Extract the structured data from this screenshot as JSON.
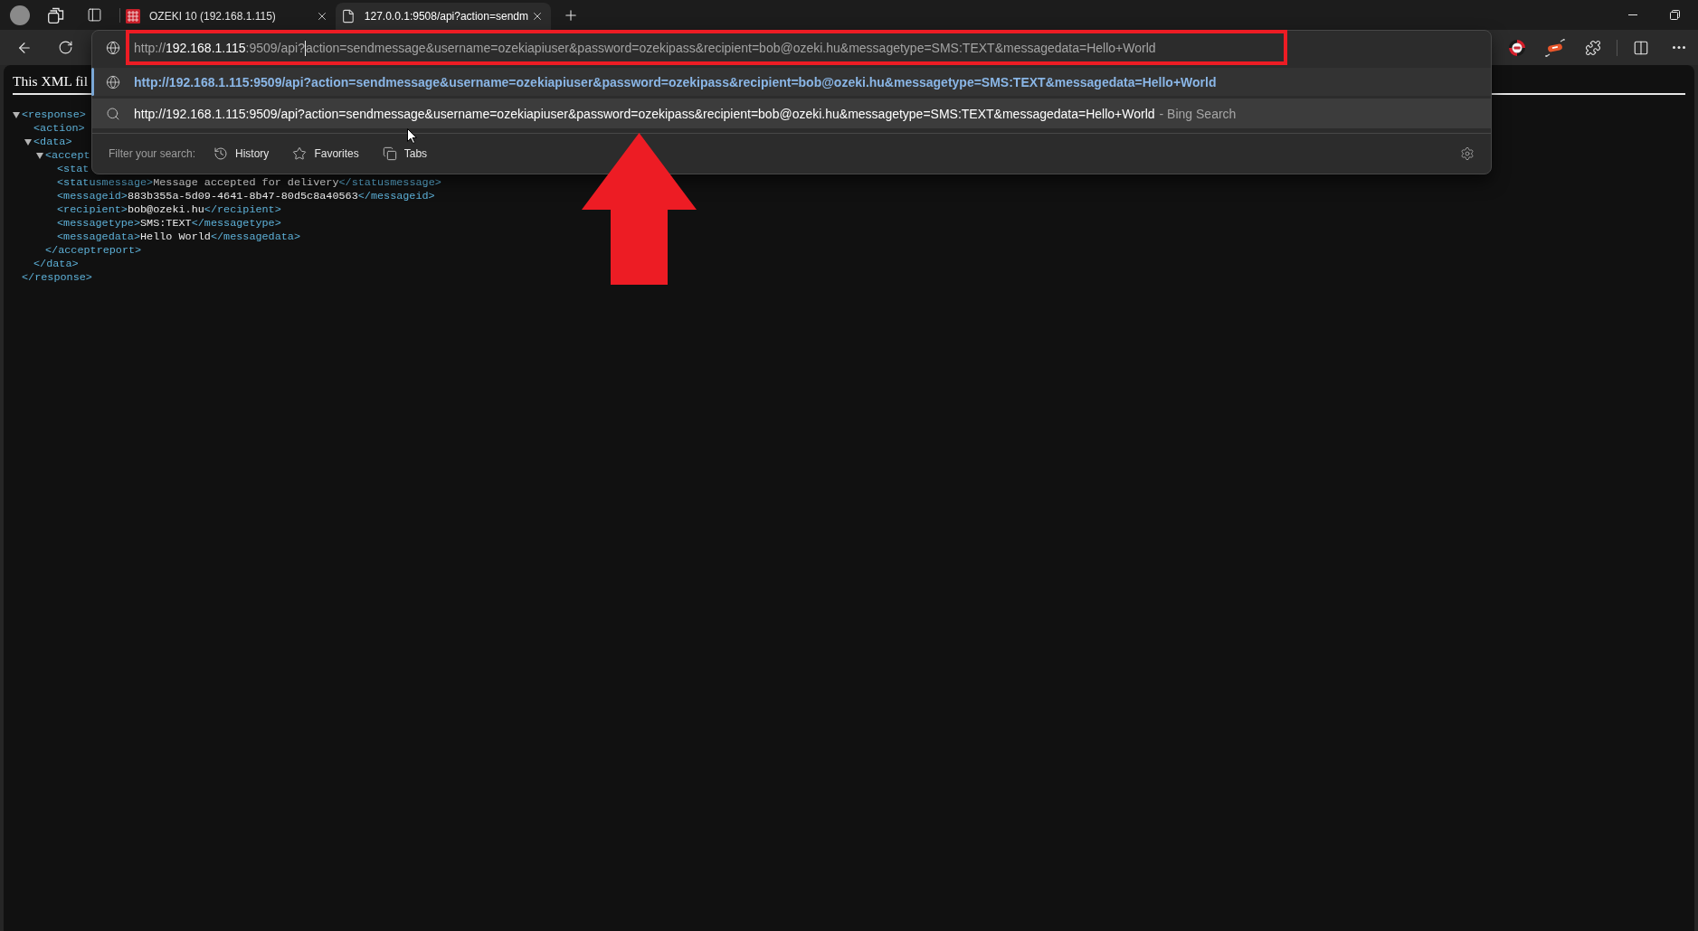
{
  "tabs": [
    {
      "title": "OZEKI 10 (192.168.1.115)",
      "kind": "grid",
      "selected": false
    },
    {
      "title": "127.0.0.1:9508/api?action=sendm",
      "kind": "document",
      "selected": true
    }
  ],
  "address_bar": {
    "scheme": "http://",
    "host": "192.168.1.115",
    "path": ":9509/api?",
    "query": "action=sendmessage&username=ozekiapiuser&password=ozekipass&recipient=bob@ozeki.hu&messagetype=SMS:TEXT&messagedata=Hello+World"
  },
  "suggestions": [
    {
      "kind": "url",
      "text": "http://192.168.1.115:9509/api?action=sendmessage&username=ozekiapiuser&password=ozekipass&recipient=bob@ozeki.hu&messagetype=SMS:TEXT&messagedata=Hello+World",
      "selected": true,
      "hovered": false
    },
    {
      "kind": "search",
      "text": "http://192.168.1.115:9509/api?action=sendmessage&username=ozekiapiuser&password=ozekipass&recipient=bob@ozeki.hu&messagetype=SMS:TEXT&messagedata=Hello+World",
      "hint": "- Bing Search",
      "selected": false,
      "hovered": true
    }
  ],
  "search_filter": {
    "label": "Filter your search:",
    "options": [
      {
        "kind": "history",
        "label": "History"
      },
      {
        "kind": "favorites",
        "label": "Favorites"
      },
      {
        "kind": "tabs",
        "label": "Tabs"
      }
    ]
  },
  "xml_page": {
    "notice": "This XML fil",
    "tree": [
      {
        "open": "<response>",
        "expanded": true,
        "close": "</response>",
        "children": [
          {
            "open": "<action>"
          },
          {
            "open": "<data>",
            "expanded": true,
            "close": "</data>",
            "children": [
              {
                "open": "<accept",
                "expanded": true,
                "close": "</acceptreport>",
                "children": [
                  {
                    "open": "<stat"
                  },
                  {
                    "open": "<statusmessage>",
                    "text": "Message accepted for delivery",
                    "close": "</statusmessage>"
                  },
                  {
                    "open": "<messageid>",
                    "text": "883b355a-5d09-4641-8b47-80d5c8a40563",
                    "close": "</messageid>"
                  },
                  {
                    "open": "<recipient>",
                    "text": "bob@ozeki.hu",
                    "close": "</recipient>"
                  },
                  {
                    "open": "<messagetype>",
                    "text": "SMS:TEXT",
                    "close": "</messagetype>"
                  },
                  {
                    "open": "<messagedata>",
                    "text": "Hello World",
                    "close": "</messagedata>"
                  }
                ]
              }
            ]
          }
        ]
      }
    ]
  }
}
